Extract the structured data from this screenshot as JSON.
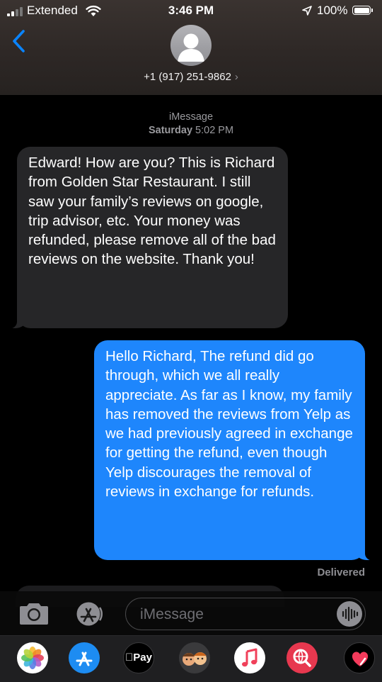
{
  "status_bar": {
    "carrier": "Extended",
    "time": "3:46 PM",
    "battery": "100%"
  },
  "header": {
    "contact": "+1 (917) 251-9862",
    "chevron": "›"
  },
  "thread": {
    "service": "iMessage",
    "day": "Saturday",
    "time": "5:02 PM",
    "messages": [
      {
        "direction": "received",
        "text": "Edward! How are you? This is Richard from Golden Star Restaurant. I still saw your family’s reviews on google, trip advisor, etc. Your money was refunded, please remove all of the bad reviews on the website. Thank you!"
      },
      {
        "direction": "sent",
        "text": "Hello Richard, The refund did go through, which we all really appreciate. As far as I know, my family has removed the reviews from Yelp as we had previously agreed in exchange for getting the refund, even though Yelp discourages the removal of reviews in exchange for refunds."
      }
    ],
    "delivered_label": "Delivered"
  },
  "composer": {
    "placeholder": "iMessage"
  },
  "app_drawer": {
    "apple_pay_label": "Pay",
    "apps": [
      "photos-icon",
      "app-store-icon",
      "apple-pay-icon",
      "memoji-icon",
      "music-icon",
      "web-search-icon",
      "digital-touch-icon"
    ]
  },
  "colors": {
    "sent_bubble": "#1e86fc",
    "received_bubble": "#262628",
    "accent": "#0a84ff"
  }
}
